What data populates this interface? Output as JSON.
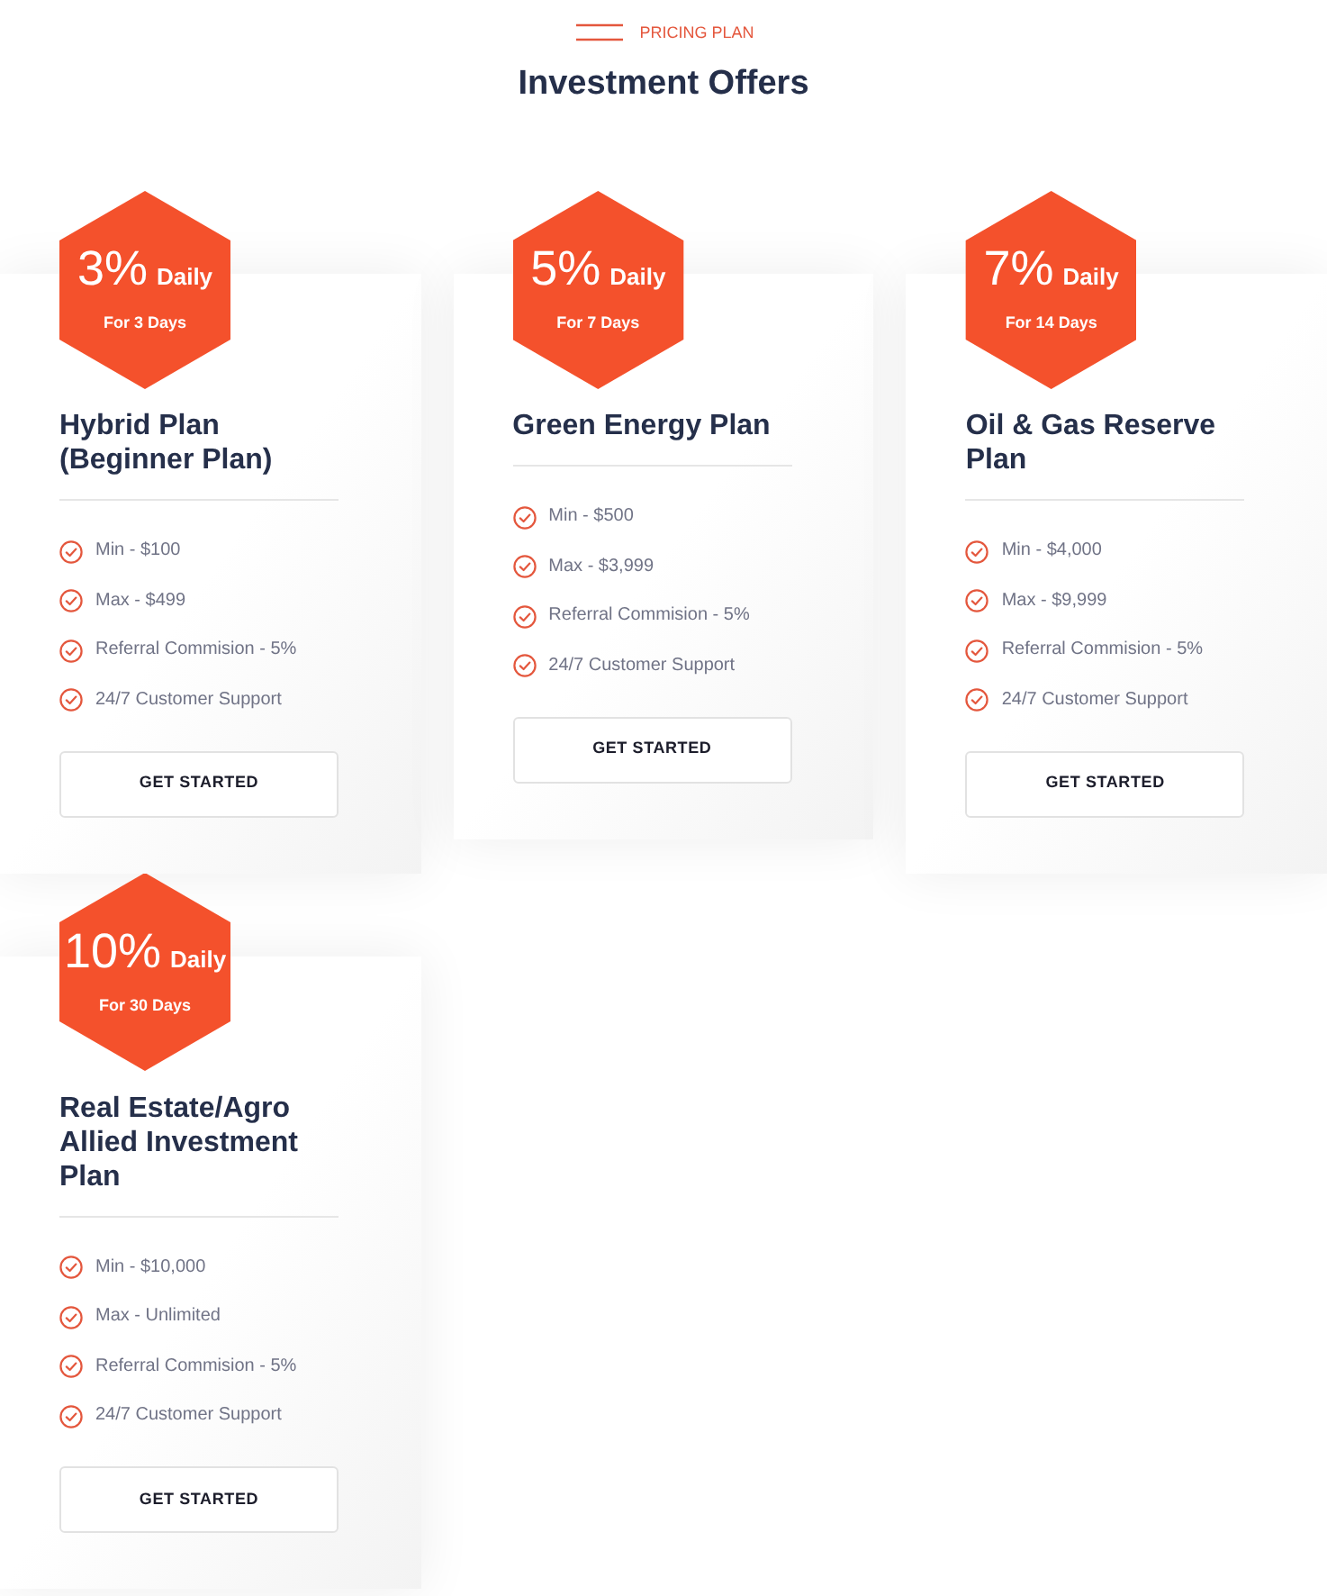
{
  "header": {
    "eyebrow": "PRICING PLAN",
    "title": "Investment Offers"
  },
  "plans": [
    {
      "rate": "3%",
      "period": "Daily",
      "duration": "For 3 Days",
      "name": "Hybrid Plan (Beginner Plan)",
      "features": [
        "Min - $100",
        "Max - $499",
        "Referral Commision - 5%",
        "24/7 Customer Support"
      ],
      "button": "GET STARTED"
    },
    {
      "rate": "5%",
      "period": "Daily",
      "duration": "For 7 Days",
      "name": "Green Energy Plan",
      "features": [
        "Min - $500",
        "Max - $3,999",
        "Referral Commision - 5%",
        "24/7 Customer Support"
      ],
      "button": "GET STARTED"
    },
    {
      "rate": "7%",
      "period": "Daily",
      "duration": "For 14 Days",
      "name": "Oil & Gas Reserve Plan",
      "features": [
        "Min - $4,000",
        "Max - $9,999",
        "Referral Commision - 5%",
        "24/7 Customer Support"
      ],
      "button": "GET STARTED"
    },
    {
      "rate": "10%",
      "period": "Daily",
      "duration": "For 30 Days",
      "name": "Real Estate/Agro Allied Investment Plan",
      "features": [
        "Min - $10,000",
        "Max - Unlimited",
        "Referral Commision - 5%",
        "24/7 Customer Support"
      ],
      "button": "GET STARTED"
    }
  ]
}
